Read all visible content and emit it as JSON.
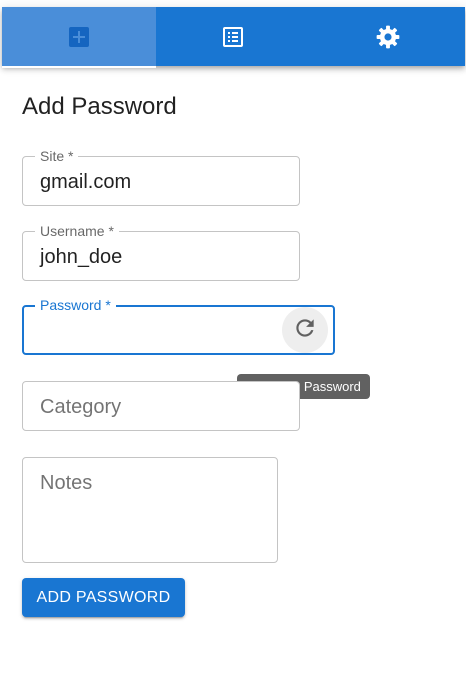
{
  "tabs": [
    {
      "name": "add",
      "icon": "add-box-icon",
      "active": true
    },
    {
      "name": "list",
      "icon": "list-alt-icon",
      "active": false
    },
    {
      "name": "settings",
      "icon": "gear-icon",
      "active": false
    }
  ],
  "page": {
    "title": "Add Password"
  },
  "form": {
    "site": {
      "label": "Site *",
      "value": "gmail.com"
    },
    "username": {
      "label": "Username *",
      "value": "john_doe"
    },
    "password": {
      "label": "Password *",
      "value": ""
    },
    "category": {
      "placeholder": "Category"
    },
    "notes": {
      "placeholder": "Notes"
    }
  },
  "tooltip": {
    "text": "Generate Password"
  },
  "submit": {
    "label": "ADD PASSWORD"
  },
  "colors": {
    "primary": "#1976d2",
    "tab_active_bg": "#4a8ed9",
    "tooltip_bg": "#616161"
  }
}
